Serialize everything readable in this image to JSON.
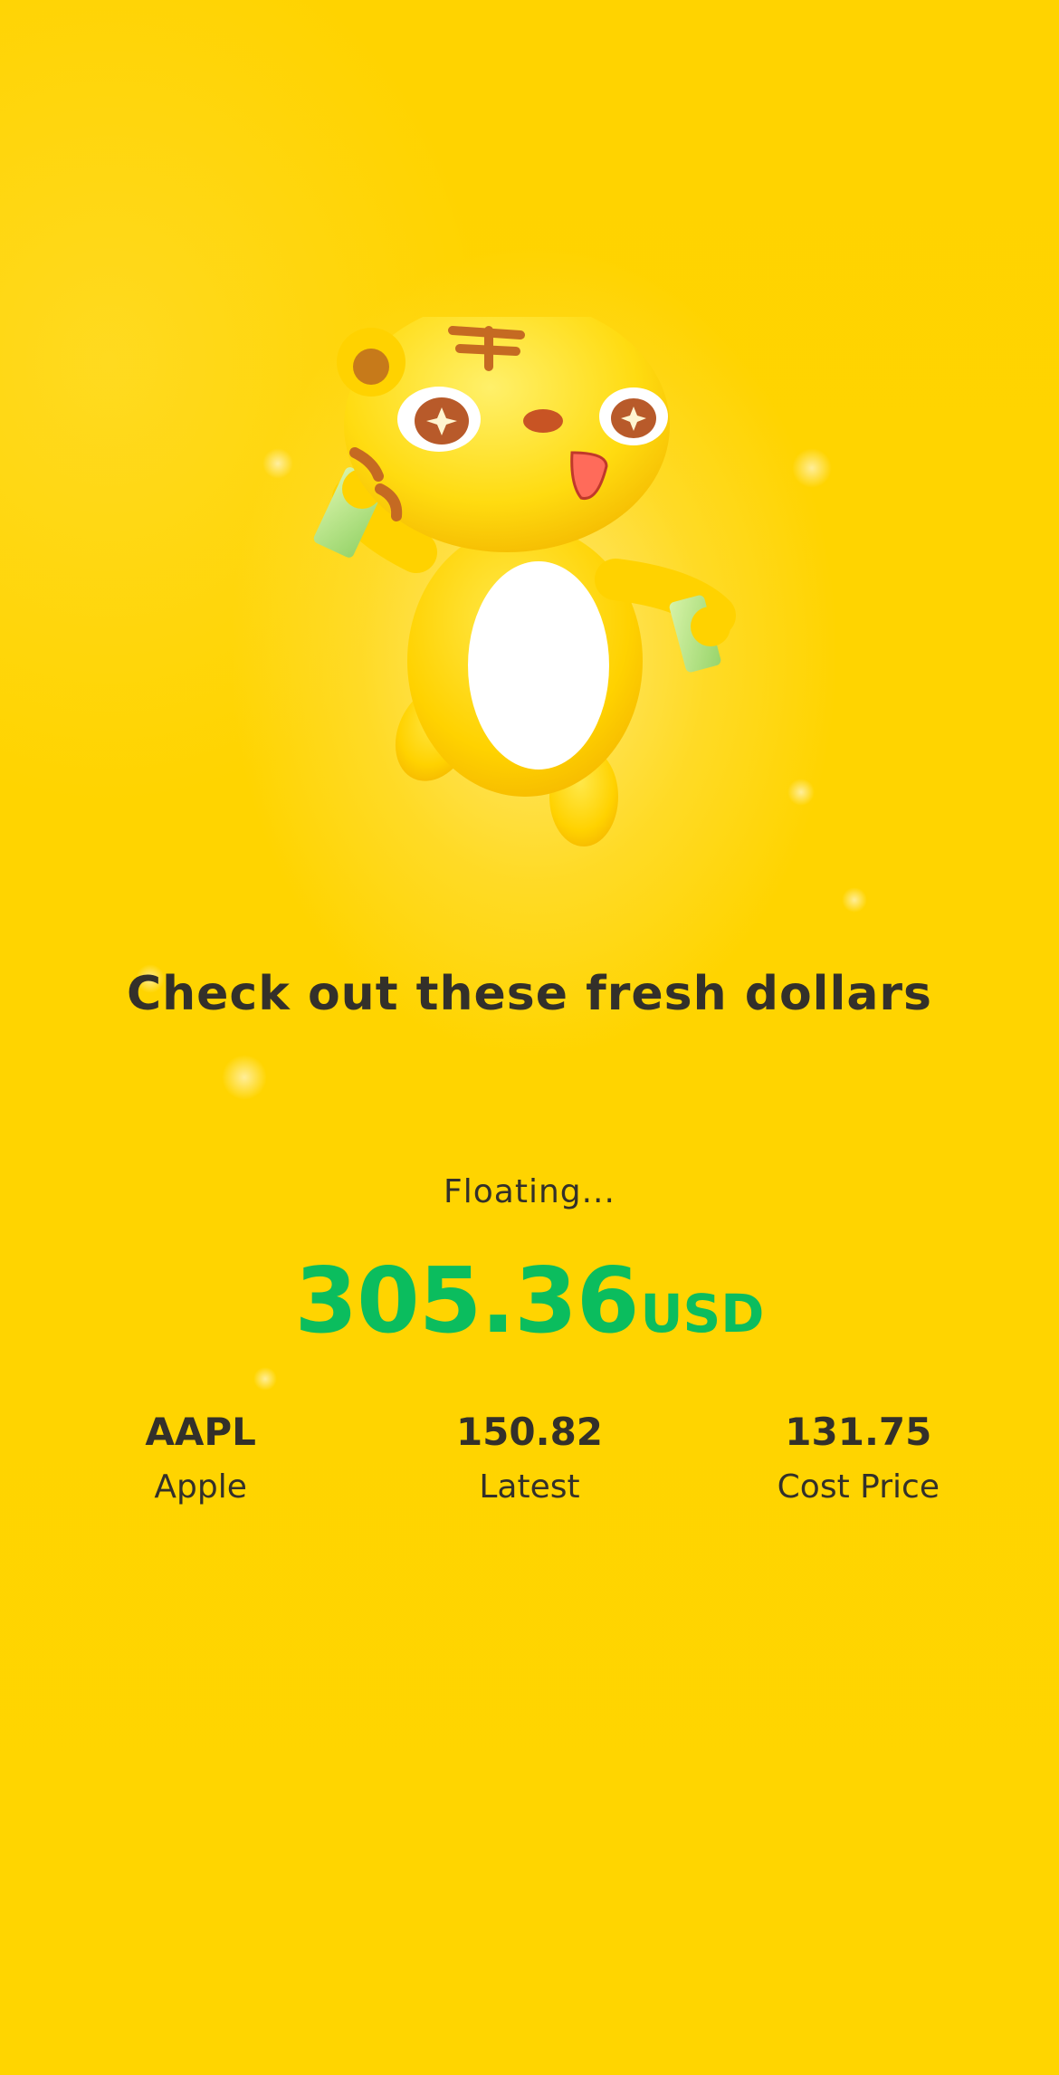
{
  "headline": "Check out these fresh dollars",
  "status": "Floating...",
  "profit": {
    "amount": "305.36",
    "currency": "USD",
    "color": "#0bbd5e"
  },
  "stats": [
    {
      "value": "AAPL",
      "label": "Apple"
    },
    {
      "value": "150.82",
      "label": "Latest"
    },
    {
      "value": "131.75",
      "label": "Cost Price"
    }
  ],
  "colors": {
    "background": "#ffd400",
    "text": "#33302a"
  },
  "illustration": "tiger-mascot-holding-cash"
}
